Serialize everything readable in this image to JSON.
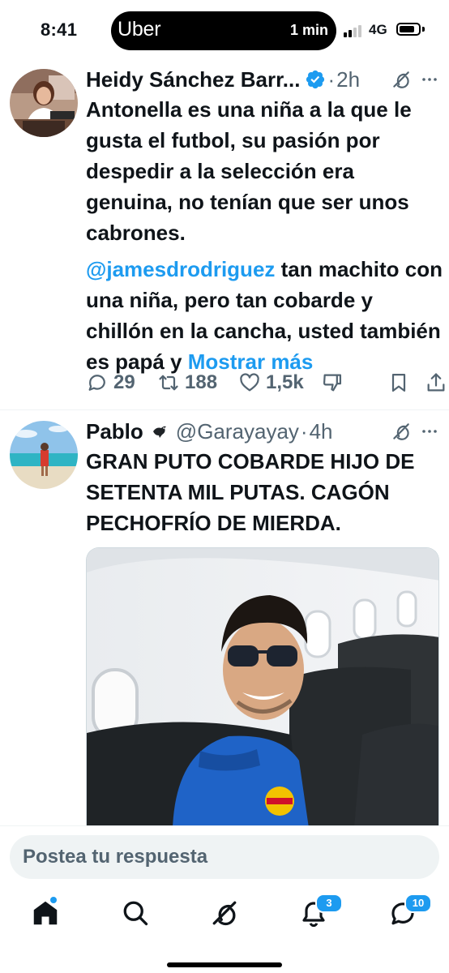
{
  "status_bar": {
    "time": "8:41",
    "live_activity_app": "Uber",
    "live_activity_time": "1 min",
    "network": "4G"
  },
  "tweets": [
    {
      "display_name": "Heidy Sánchez Barr...",
      "verified": true,
      "separator": "·",
      "time": "2h",
      "paragraphs": [
        "Antonella es una niña a la que le gusta el futbol, su pasión por despedir a la selección era genuina, no tenían que ser unos cabrones."
      ],
      "mention": "@jamesdrodriguez",
      "after_mention": " tan machito con una niña, pero tan cobarde y chillón en la cancha, usted también es papá y ",
      "show_more": "Mostrar más",
      "stats": {
        "replies": "29",
        "reposts": "188",
        "likes": "1,5k"
      }
    },
    {
      "display_name": "Pablo",
      "emoji_icon": "bird-emoji-icon",
      "handle": "@Garayayay",
      "separator": "·",
      "time": "4h",
      "text": "GRAN PUTO COBARDE HIJO DE SETENTA MIL PUTAS. CAGÓN PECHOFRÍO DE MIERDA.",
      "media": "photo-man-sunglasses-airplane"
    }
  ],
  "reply": {
    "placeholder": "Postea tu respuesta"
  },
  "tabbar": {
    "items": [
      "home-icon",
      "search-icon",
      "grok-icon",
      "notifications-icon",
      "messages-icon"
    ],
    "notifications_badge": "3",
    "messages_badge": "10"
  },
  "colors": {
    "accent": "#1d9bf0",
    "secondary_text": "#536471",
    "primary_text": "#0f1419"
  }
}
